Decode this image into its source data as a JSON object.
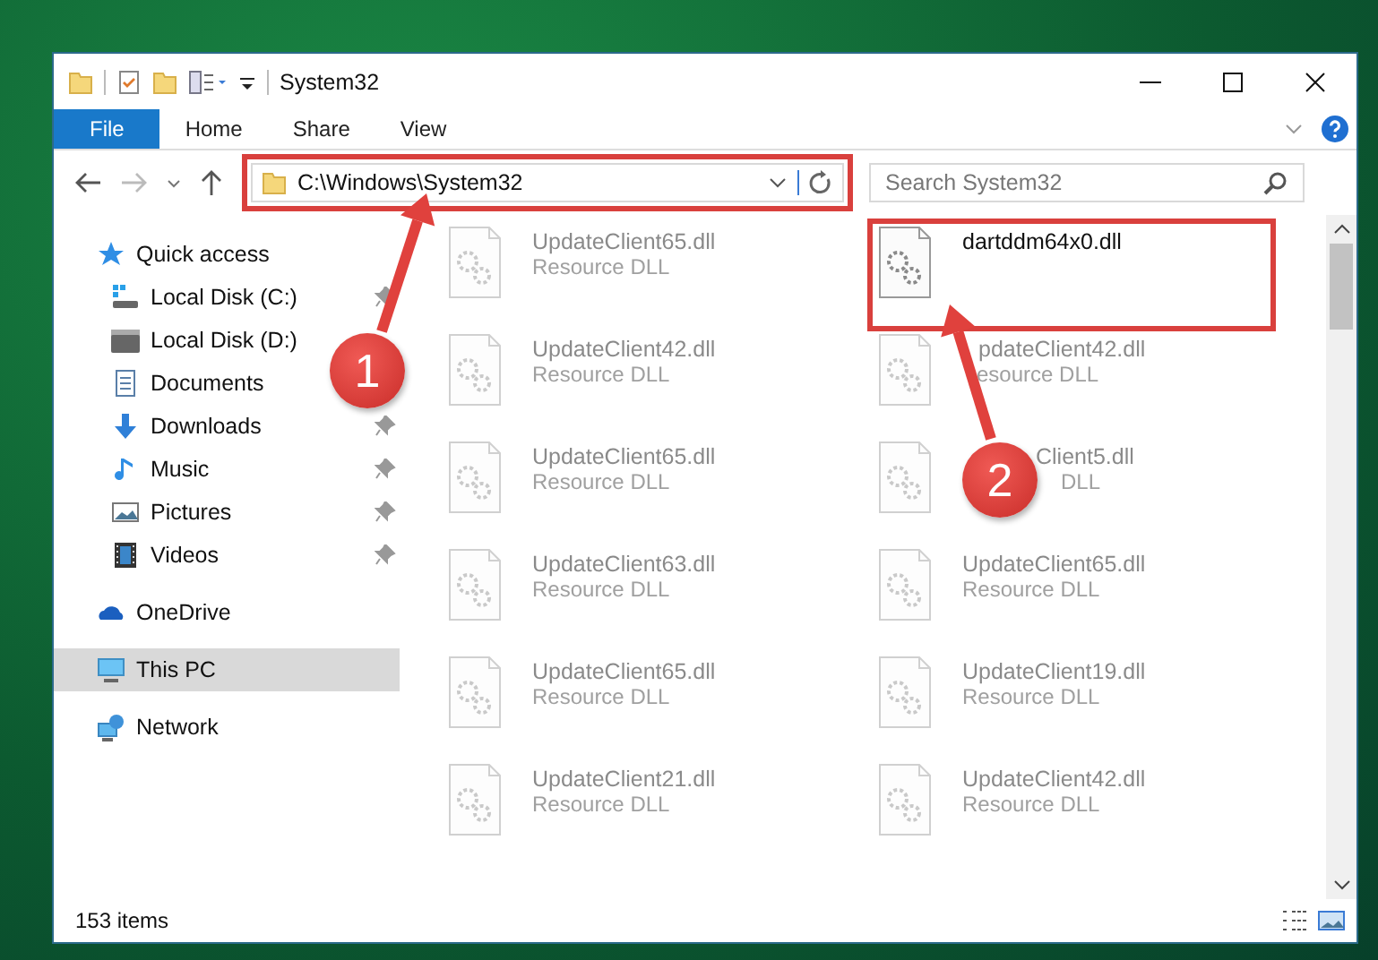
{
  "window": {
    "title": "System32"
  },
  "ribbon_tabs": [
    {
      "label": "File",
      "selected": true
    },
    {
      "label": "Home",
      "selected": false
    },
    {
      "label": "Share",
      "selected": false
    },
    {
      "label": "View",
      "selected": false
    }
  ],
  "address": {
    "path": "C:\\Windows\\System32"
  },
  "search": {
    "placeholder": "Search System32"
  },
  "navigation": [
    {
      "label": "Quick access",
      "kind": "star",
      "selected": false,
      "children": [
        {
          "label": "Local Disk (C:)",
          "kind": "windows-drive",
          "pinned": true,
          "selected": false
        },
        {
          "label": "Local Disk (D:)",
          "kind": "drive",
          "pinned": false,
          "selected": false
        },
        {
          "label": "Documents",
          "kind": "documents",
          "pinned": false,
          "selected": false
        },
        {
          "label": "Downloads",
          "kind": "downloads",
          "pinned": true,
          "selected": false
        },
        {
          "label": "Music",
          "kind": "music",
          "pinned": true,
          "selected": false
        },
        {
          "label": "Pictures",
          "kind": "pictures",
          "pinned": true,
          "selected": false
        },
        {
          "label": "Videos",
          "kind": "videos",
          "pinned": true,
          "selected": false
        }
      ]
    },
    {
      "label": "OneDrive",
      "kind": "cloud",
      "selected": false
    },
    {
      "label": "This PC",
      "kind": "pc",
      "selected": true
    },
    {
      "label": "Network",
      "kind": "network",
      "selected": false
    }
  ],
  "files": [
    {
      "name": "UpdateClient65.dll",
      "type": "Resource DLL",
      "blurred": true
    },
    {
      "name": "dartddm64x0.dll",
      "blurred": false
    },
    {
      "name": "UpdateClient42.dll",
      "type": "Resource DLL",
      "blurred": true
    },
    {
      "name": "pdateClient42.dll",
      "type": "esource DLL",
      "blurred": true
    },
    {
      "name": "UpdateClient65.dll",
      "type": "Resource DLL",
      "blurred": true
    },
    {
      "name": "Client5.dll",
      "type": "DLL",
      "blurred": true
    },
    {
      "name": "UpdateClient63.dll",
      "type": "Resource DLL",
      "blurred": true
    },
    {
      "name": "UpdateClient65.dll",
      "type": "Resource DLL",
      "blurred": true
    },
    {
      "name": "UpdateClient65.dll",
      "type": "Resource DLL",
      "blurred": true
    },
    {
      "name": "UpdateClient19.dll",
      "type": "Resource DLL",
      "blurred": true
    },
    {
      "name": "UpdateClient21.dll",
      "type": "Resource DLL",
      "blurred": true
    },
    {
      "name": "UpdateClient42.dll",
      "type": "Resource DLL",
      "blurred": true
    }
  ],
  "status_bar": {
    "item_count": "153 items"
  },
  "annotations": [
    {
      "number": "1"
    },
    {
      "number": "2"
    }
  ]
}
